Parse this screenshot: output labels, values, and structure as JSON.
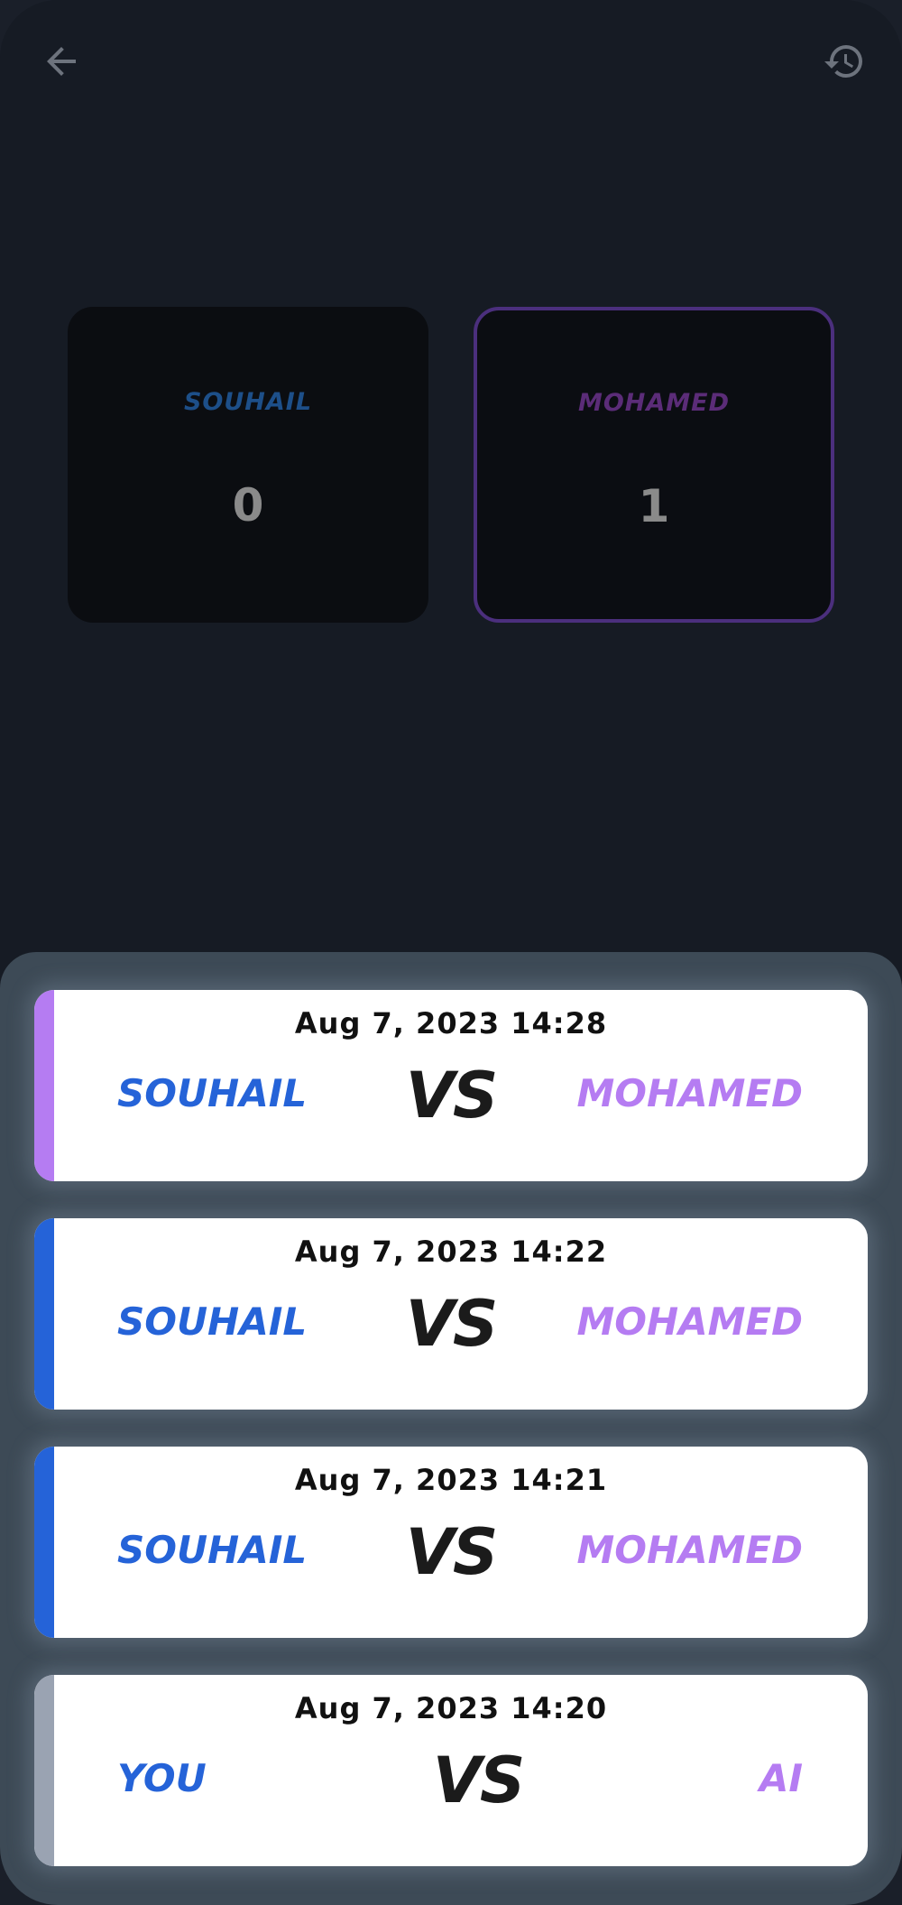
{
  "colors": {
    "background": "#161b24",
    "sheet": "#3d4a56",
    "player1": "#2563d8",
    "player2": "#b57cf2",
    "neutral_bar": "#9aa3b2"
  },
  "icons": {
    "back": "arrow-left-icon",
    "history": "history-icon"
  },
  "scoreboard": {
    "left": {
      "name": "SOUHAIL",
      "score": "0"
    },
    "right": {
      "name": "MOHAMED",
      "score": "1"
    }
  },
  "history": [
    {
      "date": "Aug 7, 2023 14:28",
      "player1": "SOUHAIL",
      "vs": "VS",
      "player2": "MOHAMED",
      "bar_color": "#b57cf2"
    },
    {
      "date": "Aug 7, 2023 14:22",
      "player1": "SOUHAIL",
      "vs": "VS",
      "player2": "MOHAMED",
      "bar_color": "#2563d8"
    },
    {
      "date": "Aug 7, 2023 14:21",
      "player1": "SOUHAIL",
      "vs": "VS",
      "player2": "MOHAMED",
      "bar_color": "#2563d8"
    },
    {
      "date": "Aug 7, 2023 14:20",
      "player1": "YOU",
      "vs": "VS",
      "player2": "AI",
      "bar_color": "#9aa3b2"
    }
  ]
}
